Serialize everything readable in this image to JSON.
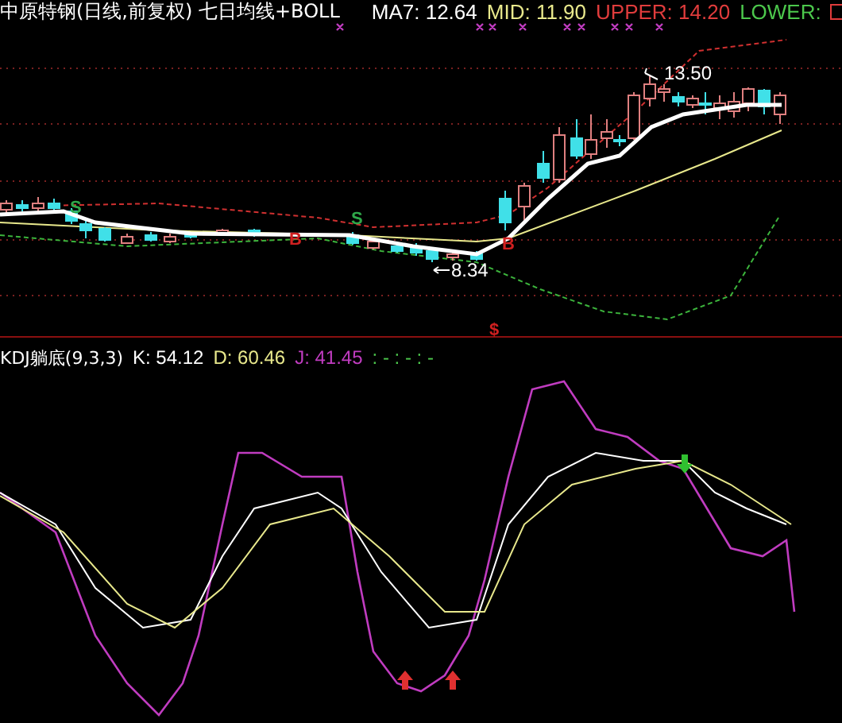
{
  "price_panel": {
    "title": "中原特钢(日线,前复权) 七日均线+BOLL",
    "indicators": [
      {
        "label": "MA7: 12.64",
        "color": "#ffffff"
      },
      {
        "label": "MID: 11.90",
        "color": "#e8e88c"
      },
      {
        "label": "UPPER: 14.20",
        "color": "#e03c3c"
      },
      {
        "label": "LOWER:",
        "color": "#4cc84c"
      }
    ],
    "annotations": [
      {
        "kind": "high",
        "text": "13.50"
      },
      {
        "kind": "low",
        "text": "8.34"
      }
    ],
    "signals": [
      {
        "text": "S",
        "color": "#2fa84a"
      },
      {
        "text": "B",
        "color": "#d02020"
      },
      {
        "text": "S",
        "color": "#2fa84a"
      },
      {
        "text": "B",
        "color": "#d02020"
      },
      {
        "text": "$",
        "color": "#d02020"
      }
    ]
  },
  "kdj_panel": {
    "title": "KDJ躺底(9,3,3)",
    "indicators": [
      {
        "label": "K: 54.12",
        "color": "#ffffff"
      },
      {
        "label": "D: 60.46",
        "color": "#e8e88c"
      },
      {
        "label": "J: 41.45",
        "color": "#c03cc0"
      },
      {
        "label": ": - : - : -",
        "color": "#4cc84c"
      }
    ]
  }
}
